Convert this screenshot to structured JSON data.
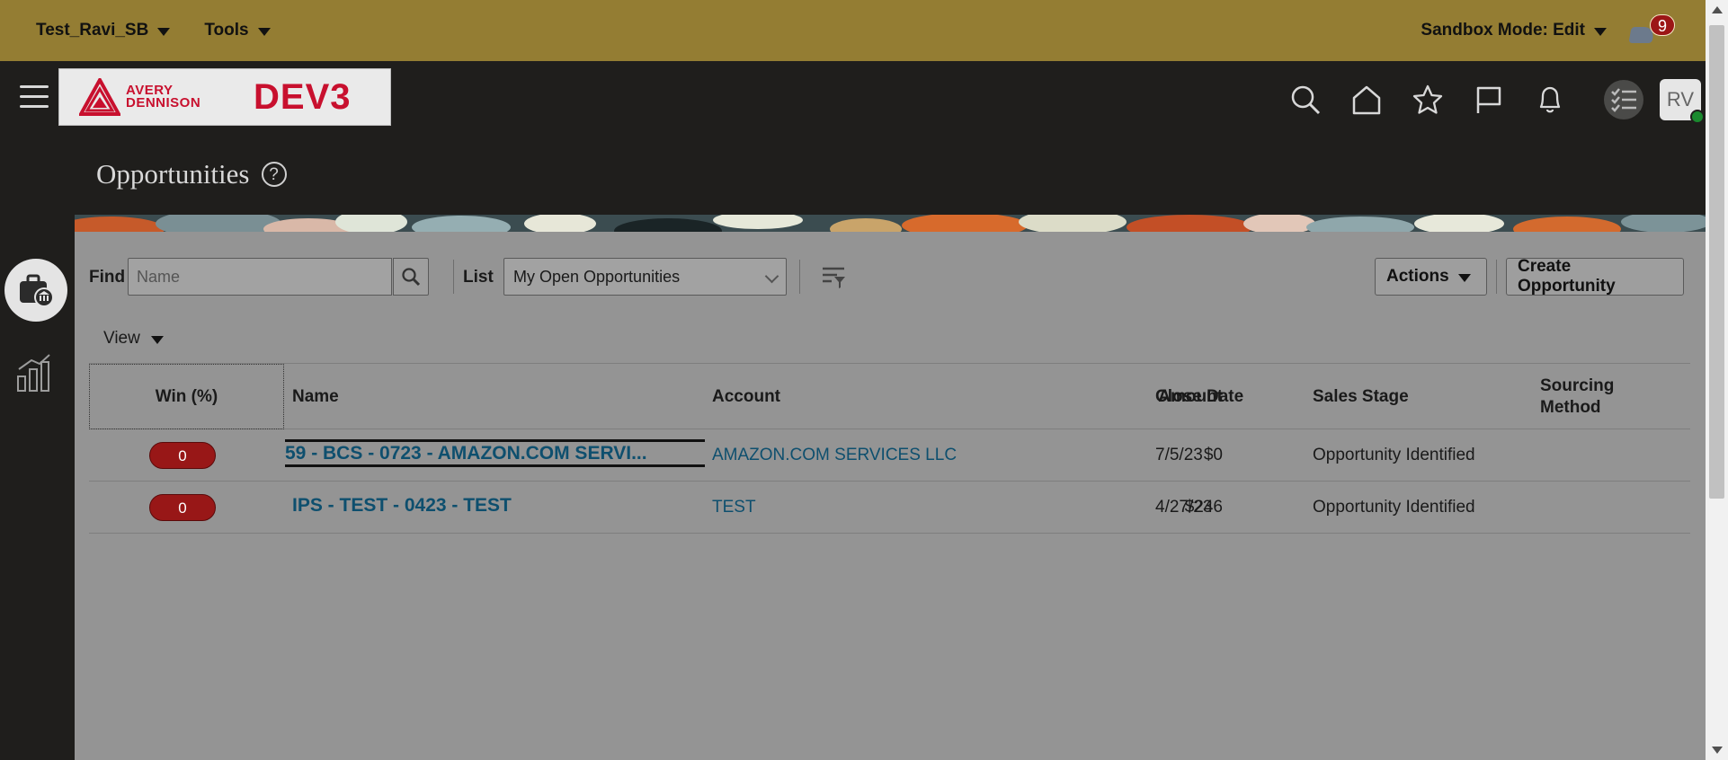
{
  "sandbox_bar": {
    "sandbox_name": "Test_Ravi_SB",
    "tools_label": "Tools",
    "mode_label": "Sandbox Mode: Edit",
    "notification_count": "9"
  },
  "header": {
    "logo_text": "AVERY DENNISON",
    "env_label": "DEV3",
    "avatar_initials": "RV",
    "icons": [
      "search-icon",
      "home-icon",
      "favorites-icon",
      "flag-icon",
      "notifications-icon",
      "tasks-icon"
    ]
  },
  "page": {
    "title": "Opportunities",
    "help": "?"
  },
  "toolbar": {
    "find_label": "Find",
    "find_placeholder": "Name",
    "list_label": "List",
    "list_value": "My Open Opportunities",
    "actions_label": "Actions",
    "create_label": "Create Opportunity",
    "view_label": "View"
  },
  "table": {
    "columns": {
      "win": "Win (%)",
      "name": "Name",
      "account": "Account",
      "amount": "Amount",
      "close_date": "Close Date",
      "sales_stage": "Sales Stage",
      "sourcing_method": "Sourcing Method"
    },
    "rows": [
      {
        "win": "0",
        "name": "59 - BCS - 0723 - AMAZON.COM SERVI...",
        "account": "AMAZON.COM SERVICES LLC",
        "amount": "$0",
        "close_date": "7/5/23",
        "sales_stage": "Opportunity Identified",
        "sourcing_method": ""
      },
      {
        "win": "0",
        "name": "IPS - TEST - 0423 - TEST",
        "account": "TEST",
        "amount": "$246",
        "close_date": "4/27/23",
        "sales_stage": "Opportunity Identified",
        "sourcing_method": ""
      }
    ]
  },
  "colors": {
    "sandbox_bar": "#947d33",
    "header_bg": "#1f1e1c",
    "brand_red": "#c8102e",
    "win_pill": "#981717",
    "link": "#0e4f6e"
  }
}
